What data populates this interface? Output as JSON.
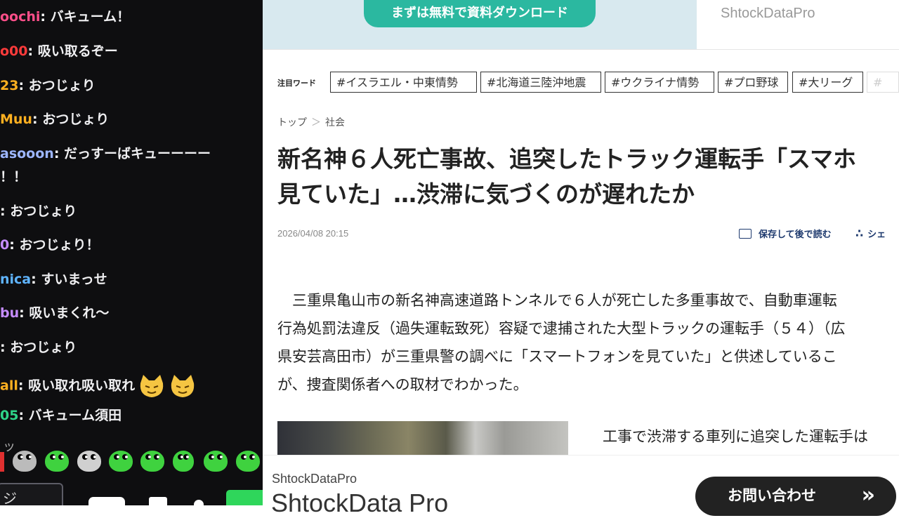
{
  "chat": {
    "messages": [
      {
        "user": "oochi",
        "color": "#ff4f8a",
        "text": "バキューム！"
      },
      {
        "user": "o00",
        "color": "#ff3b3b",
        "text": "吸い取るぞー"
      },
      {
        "user": "23",
        "color": "#ffb020",
        "text": "おつじょり"
      },
      {
        "user": "Muu",
        "color": "#ffb020",
        "text": "おつじょり"
      },
      {
        "user": "asooon",
        "color": "#9db6ff",
        "text": "だっすーばキューーーー"
      },
      {
        "user": "",
        "color": "#ffffff",
        "text": "！！"
      },
      {
        "user": "",
        "color": "#d0a0ff",
        "text": "おつじょり"
      },
      {
        "user": "0",
        "color": "#c58cff",
        "text": "おつじょり！"
      },
      {
        "user": "nica",
        "color": "#5fb4ff",
        "text": "すいまっせ"
      },
      {
        "user": "bu",
        "color": "#c58cff",
        "text": "吸いまくれ〜"
      },
      {
        "user": "",
        "color": "#ffffff",
        "text": "おつじょり"
      },
      {
        "user": "all",
        "color": "#ffb020",
        "text": "吸い取れ吸い取れ"
      },
      {
        "user": "05",
        "color": "#2fd48a",
        "text": "バキューム須田"
      }
    ],
    "partial_bottom": "ッ",
    "partial_input": "ジ"
  },
  "top_ad": {
    "button": "まずは無料で資料ダウンロード",
    "brand": "ShtockDataPro"
  },
  "trending": {
    "label": "注目ワード",
    "tags": [
      "#イスラエル・中東情勢",
      "#北海道三陸沖地震",
      "#ウクライナ情勢",
      "#プロ野球",
      "#大リーグ",
      "#"
    ]
  },
  "breadcrumb": {
    "home": "トップ",
    "sep": "＞",
    "section": "社会"
  },
  "article": {
    "headline_1": "新名神６人死亡事故、追突したトラック運転手「スマホ",
    "headline_2": "見ていた」…渋滞に気づくのが遅れたか",
    "date": "2026/04/08 20:15",
    "save_label": "保存して後で読む",
    "share_label": "シェ",
    "body_1": "　三重県亀山市の新名神高速道路トンネルで６人が死亡した多重事故で、自動車運転",
    "body_2": "行為処罰法違反（過失運転致死）容疑で逮捕された大型トラックの運転手（５４）（広",
    "body_3": "県安芸高田市）が三重県警の調べに「スマートフォンを見ていた」と供述しているこ",
    "body_4": "が、捜査関係者への取材でわかった。",
    "caption": "工事で渋滞する車列に追突した運転手は"
  },
  "bottom_ad": {
    "brand_small": "ShtockDataPro",
    "brand_big": "ShtockData Pro",
    "contact": "お問い合わせ",
    "arrow": "»"
  }
}
